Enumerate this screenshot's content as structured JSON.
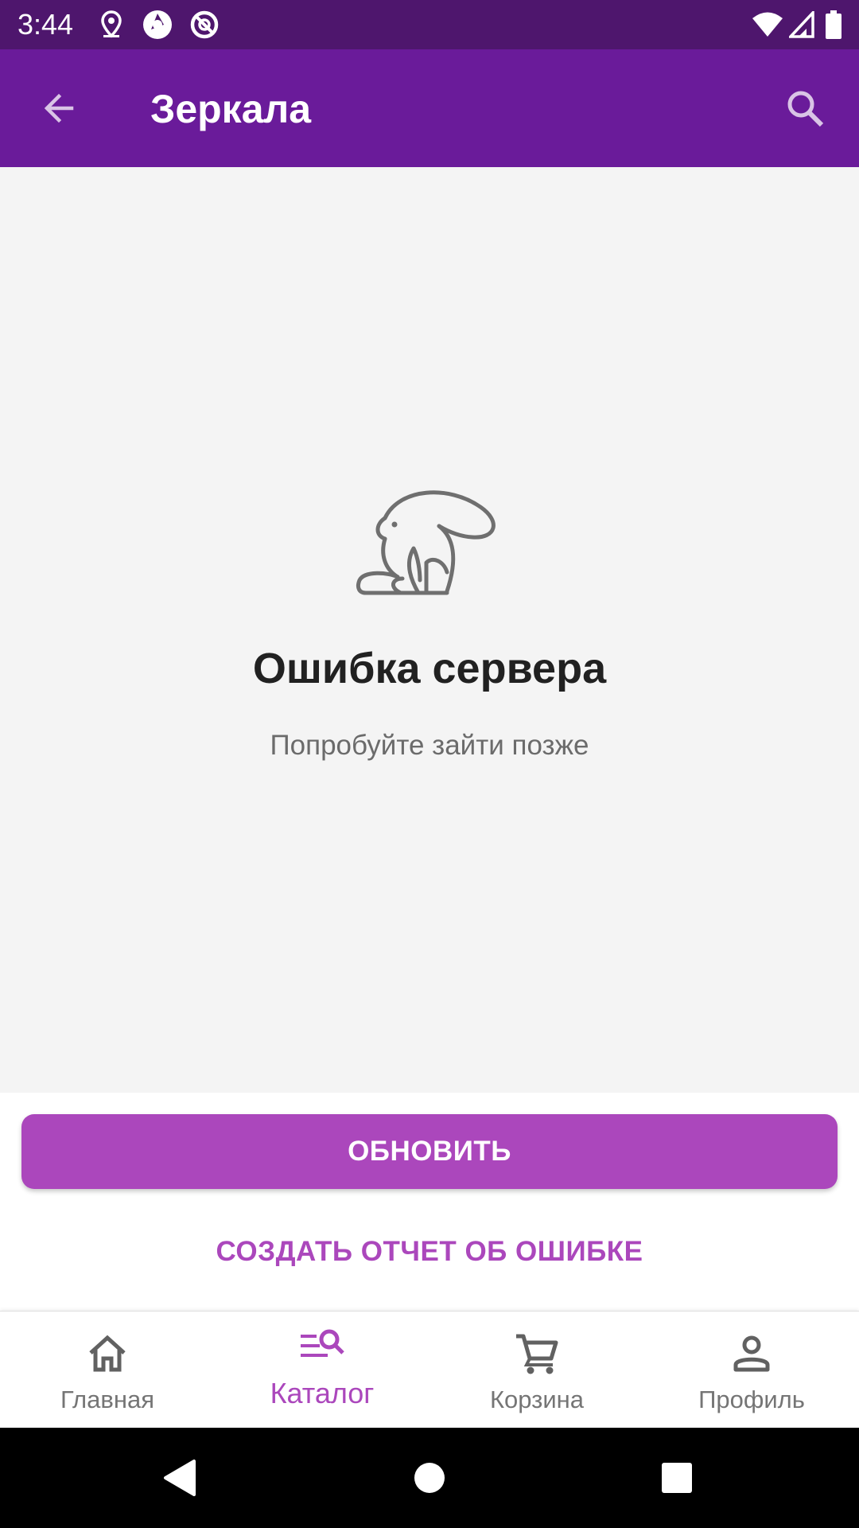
{
  "status_bar": {
    "time": "3:44",
    "left_icons": [
      "location-pin-icon",
      "shutter-app-icon",
      "no-sync-icon"
    ],
    "right_icons": [
      "wifi-icon",
      "cell-signal-icon",
      "battery-icon"
    ]
  },
  "app_bar": {
    "title": "Зеркала",
    "back_icon": "arrow-back-icon",
    "search_icon": "search-icon",
    "background": "#6a1b9a"
  },
  "error": {
    "illustration": "rabbit-icon",
    "title": "Ошибка сервера",
    "subtitle": "Попробуйте зайти позже"
  },
  "actions": {
    "refresh_label": "ОБНОВИТЬ",
    "report_label": "СОЗДАТЬ ОТЧЕТ ОБ ОШИБКЕ",
    "accent": "#ab47bc"
  },
  "bottom_nav": {
    "items": [
      {
        "label": "Главная",
        "icon": "home-icon",
        "active": false
      },
      {
        "label": "Каталог",
        "icon": "catalog-search-icon",
        "active": true
      },
      {
        "label": "Корзина",
        "icon": "cart-icon",
        "active": false
      },
      {
        "label": "Профиль",
        "icon": "profile-icon",
        "active": false
      }
    ]
  },
  "system_nav": {
    "icons": [
      "back-triangle-icon",
      "home-circle-icon",
      "recents-square-icon"
    ]
  }
}
